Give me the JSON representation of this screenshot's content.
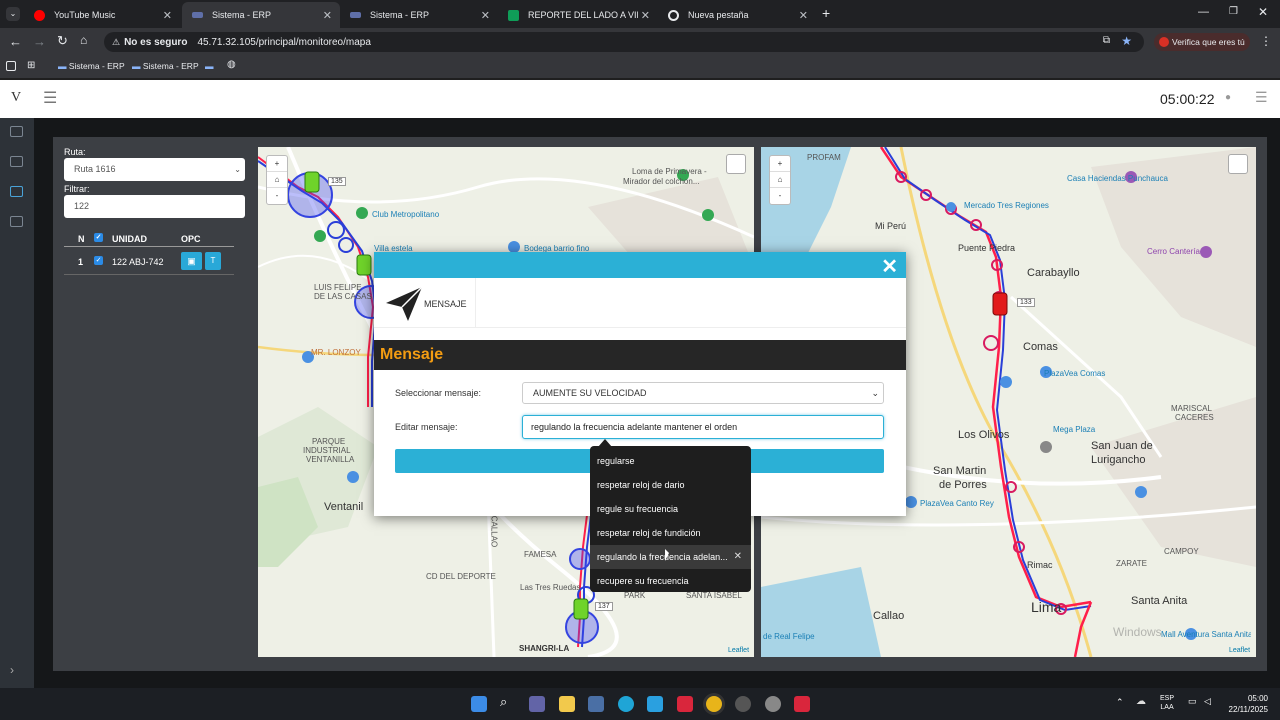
{
  "browser": {
    "tabs": [
      {
        "label": "YouTube Music",
        "color": "#ff0000"
      },
      {
        "label": "Sistema - ERP",
        "color": "#5f6fa8"
      },
      {
        "label": "Sistema - ERP",
        "color": "#5f6fa8"
      },
      {
        "label": "REPORTE DEL LADO A VIPUSA",
        "color": "#0f9d58"
      },
      {
        "label": "Nueva pestaña",
        "color": "#e8eaed"
      }
    ],
    "security": "No es seguro",
    "url": "45.71.32.105/principal/monitoreo/mapa",
    "verify_label": "Verifica que eres tú",
    "bookmarks": [
      "Sistema - ERP",
      "Sistema - ERP"
    ]
  },
  "app": {
    "logo": "V",
    "clock": "05:00:22"
  },
  "filters": {
    "ruta_label": "Ruta:",
    "ruta_value": "Ruta 1616",
    "filtrar_label": "Filtrar:",
    "filtrar_value": "122"
  },
  "table": {
    "headers": [
      "N",
      "UNIDAD",
      "OPC"
    ],
    "rows": [
      {
        "n": "1",
        "unidad": "122 ABJ-742",
        "btn_t": "T"
      }
    ]
  },
  "map_left": {
    "labels": [
      "Loma de Primavera -",
      "Mirador del colchon...",
      "Club Metropolitano",
      "Villa estela",
      "Bodega barrio fino",
      "LUIS FELIPE",
      "DE LAS CASAS",
      "MR. LONZOY",
      "PARQUE",
      "INDUSTRIAL",
      "VENTANILLA",
      "Ventanil",
      "CALLAO",
      "FAMESA",
      "CD DEL DEPORTE",
      "Las Tres Ruedas",
      "SHANGRI-LA",
      "PARK",
      "SANTA ISABEL",
      "Leaflet"
    ],
    "bus_numbers": [
      "135",
      "137"
    ]
  },
  "map_right": {
    "cities": [
      "Carabayllo",
      "Comas",
      "Los Olivos",
      "San Juan de",
      "Lurigancho",
      "San Martin",
      "de Porres",
      "Callao",
      "Lima",
      "Santa Anita",
      "Rimac"
    ],
    "pois": [
      "Casa Haciendas Punchauca",
      "Mercado Tres Regiones",
      "Cerro Cantería",
      "Puente Piedra",
      "Mi Perú",
      "PlazaVea Comas",
      "Mega Plaza",
      "PlazaVea Canto Rey",
      "Mall Aventura Santa Anita",
      "de Real Felipe"
    ],
    "bus_numbers": [
      "133"
    ],
    "small_labels": [
      "PROFAM",
      "CAMPOY",
      "ZARATE",
      "MARISCAL",
      "CACERES",
      "Leaflet"
    ]
  },
  "modal": {
    "header_label": "MENSAJE",
    "title": "Mensaje",
    "select_label": "Seleccionar mensaje:",
    "select_value": "AUMENTE SU VELOCIDAD",
    "edit_label": "Editar mensaje:",
    "edit_value": "regulando la frecuencia adelante mantener el orden"
  },
  "autocomplete": {
    "items": [
      "regularse",
      "respetar reloj de dario",
      "regule su frecuencia",
      "respetar reloj de fundición",
      "regulando la frecuencia adelan...",
      "recupere su frecuencia"
    ]
  },
  "taskbar": {
    "lang": "ESP",
    "lang2": "LAA",
    "time": "05:00",
    "date": "22/11/2025"
  },
  "watermark": "Windows"
}
